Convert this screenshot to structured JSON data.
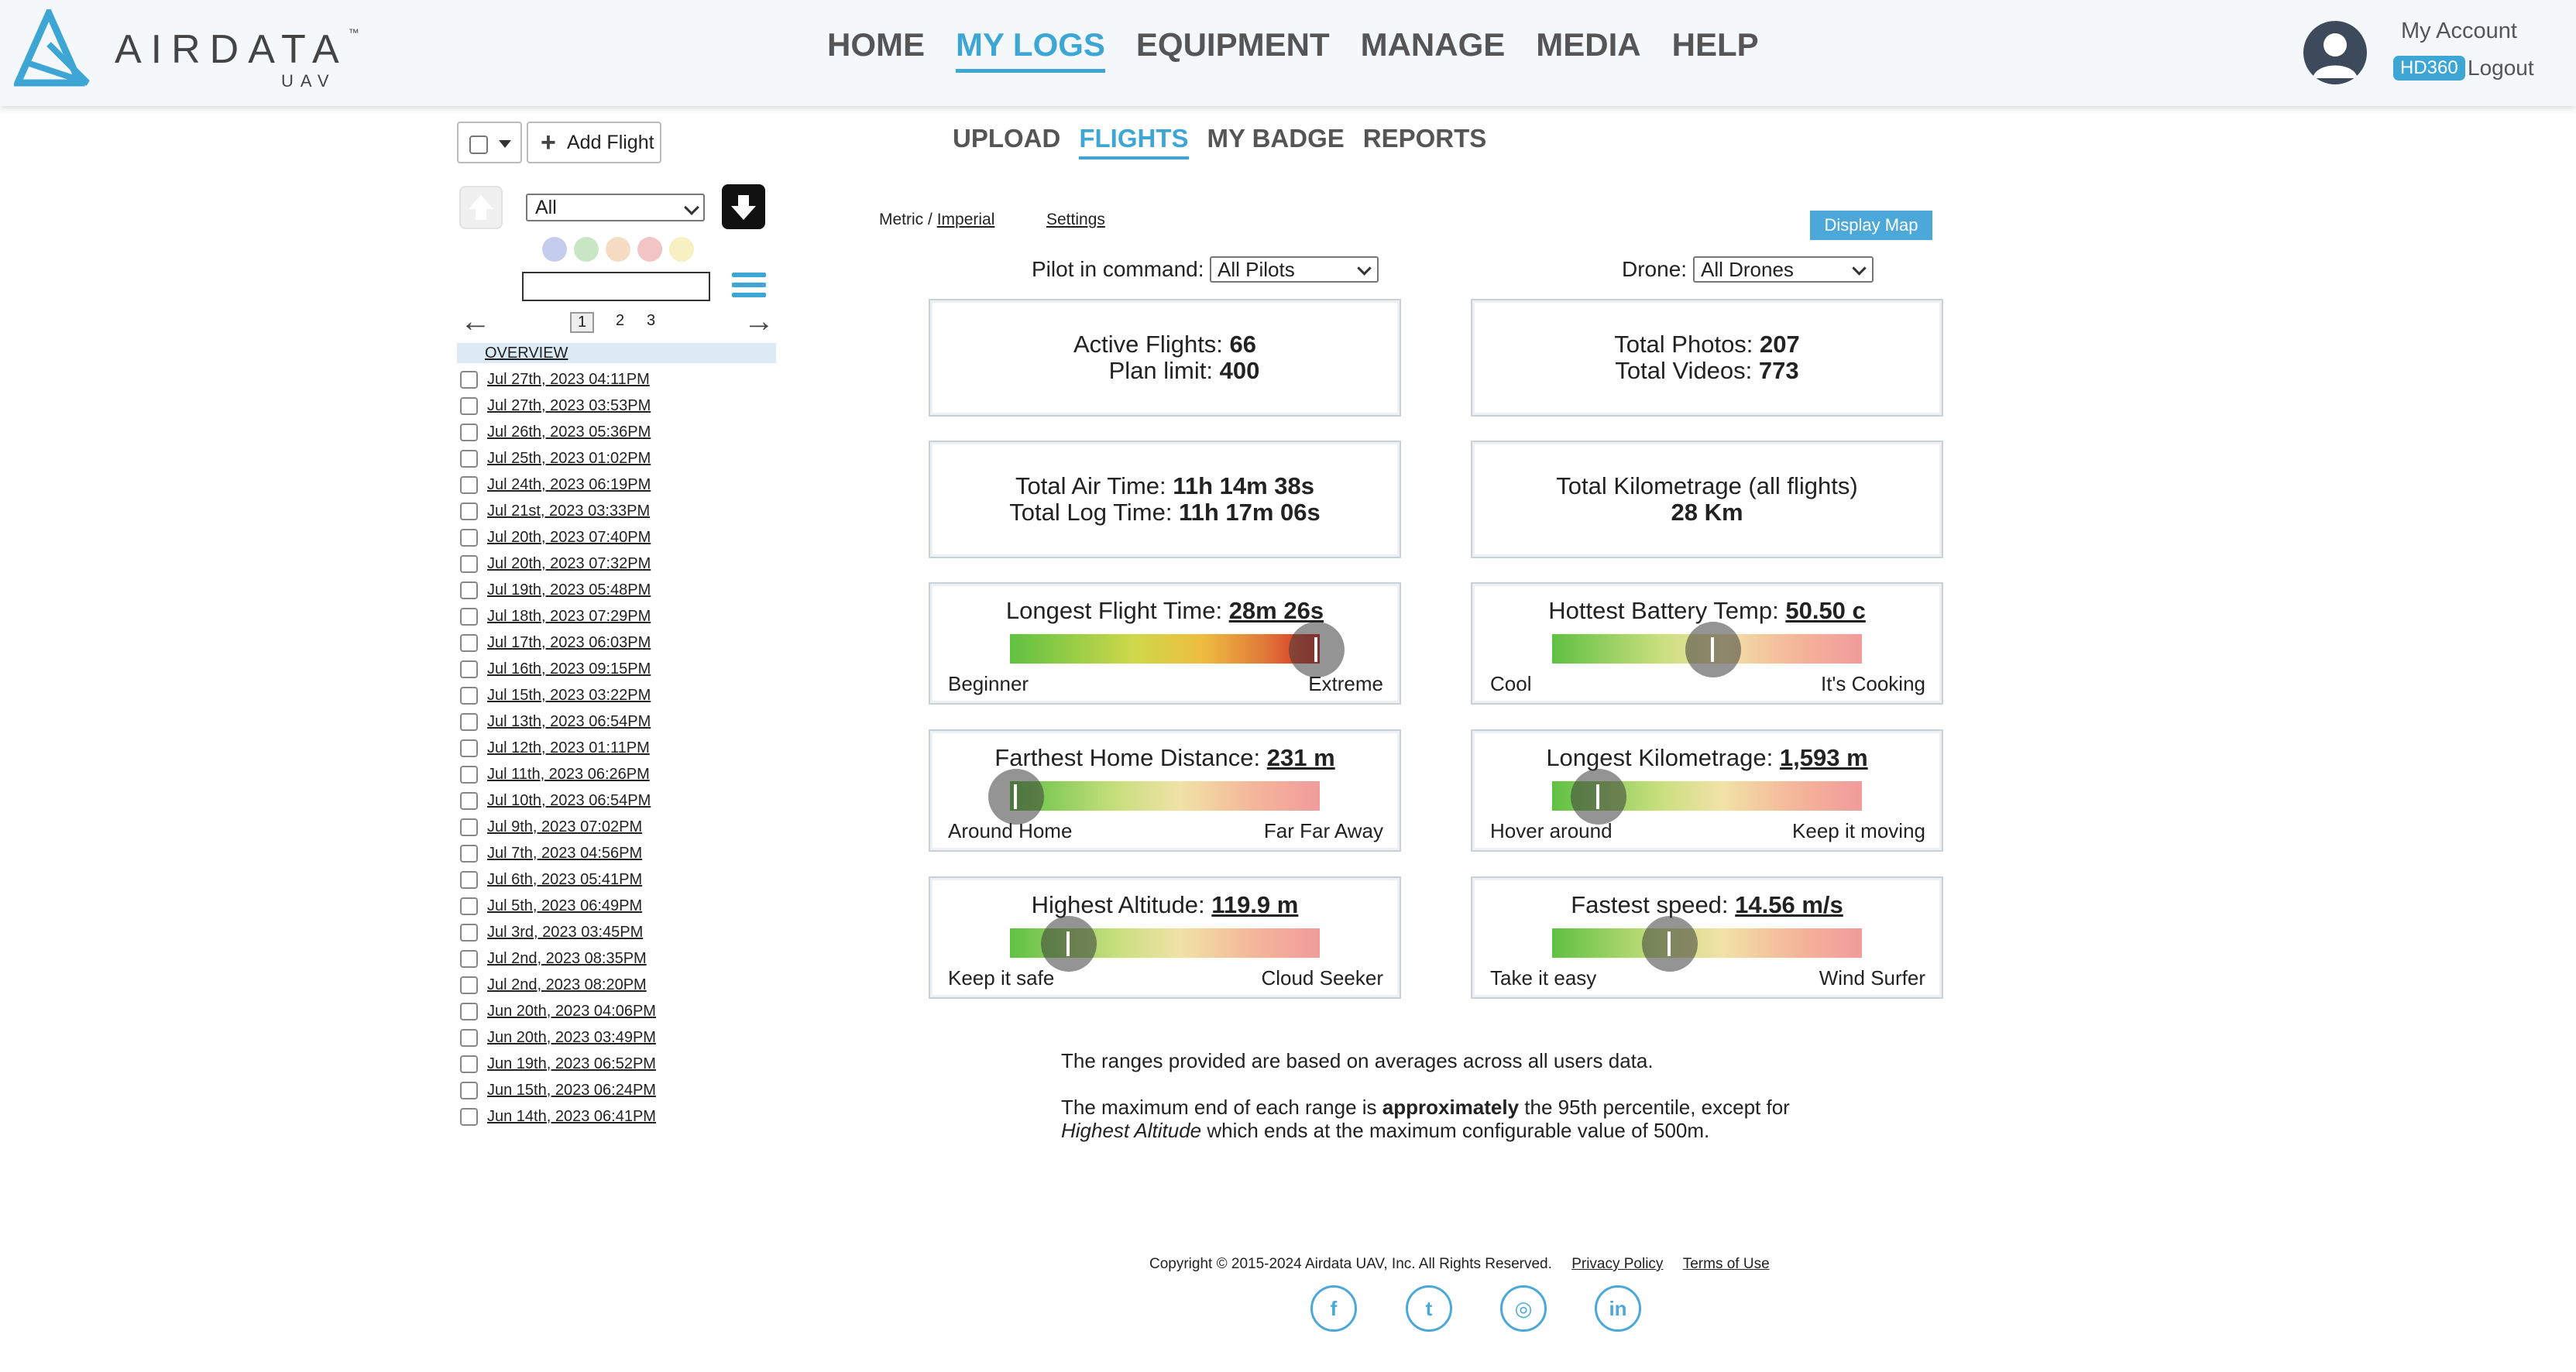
{
  "brand": {
    "name": "AIRDATA",
    "sub": "UAV",
    "tm": "™"
  },
  "nav": {
    "home": "HOME",
    "my_logs": "MY LOGS",
    "equipment": "EQUIPMENT",
    "manage": "MANAGE",
    "media": "MEDIA",
    "help": "HELP",
    "active": "MY LOGS"
  },
  "account": {
    "label": "My Account",
    "plan_badge": "HD360",
    "logout": "Logout"
  },
  "subnav": {
    "upload": "UPLOAD",
    "flights": "FLIGHTS",
    "my_badge": "MY BADGE",
    "reports": "REPORTS",
    "active": "FLIGHTS"
  },
  "sidebar": {
    "add_flight": "Add Flight",
    "filter_value": "All",
    "search_value": "",
    "pages": [
      "1",
      "2",
      "3"
    ],
    "current_page": "1",
    "overview": "OVERVIEW",
    "flights": [
      "Jul 27th, 2023 04:11PM",
      "Jul 27th, 2023 03:53PM",
      "Jul 26th, 2023 05:36PM",
      "Jul 25th, 2023 01:02PM",
      "Jul 24th, 2023 06:19PM",
      "Jul 21st, 2023 03:33PM",
      "Jul 20th, 2023 07:40PM",
      "Jul 20th, 2023 07:32PM",
      "Jul 19th, 2023 05:48PM",
      "Jul 18th, 2023 07:29PM",
      "Jul 17th, 2023 06:03PM",
      "Jul 16th, 2023 09:15PM",
      "Jul 15th, 2023 03:22PM",
      "Jul 13th, 2023 06:54PM",
      "Jul 12th, 2023 01:11PM",
      "Jul 11th, 2023 06:26PM",
      "Jul 10th, 2023 06:54PM",
      "Jul 9th, 2023 07:02PM",
      "Jul 7th, 2023 04:56PM",
      "Jul 6th, 2023 05:41PM",
      "Jul 5th, 2023 06:49PM",
      "Jul 3rd, 2023 03:45PM",
      "Jul 2nd, 2023 08:35PM",
      "Jul 2nd, 2023 08:20PM",
      "Jun 20th, 2023 04:06PM",
      "Jun 20th, 2023 03:49PM",
      "Jun 19th, 2023 06:52PM",
      "Jun 15th, 2023 06:24PM",
      "Jun 14th, 2023 06:41PM"
    ],
    "tag_colors": [
      "#c5cdef",
      "#c8e6c4",
      "#f6dcc3",
      "#f2c4c4",
      "#f7f0c2"
    ]
  },
  "toolbar": {
    "metric": "Metric",
    "sep": " / ",
    "imperial": "Imperial",
    "settings": "Settings",
    "display_map": "Display Map"
  },
  "filters": {
    "pilot_label": "Pilot in command:",
    "pilot_value": "All Pilots",
    "drone_label": "Drone:",
    "drone_value": "All Drones"
  },
  "stats": {
    "active_flights_label": "Active Flights:",
    "active_flights": "66",
    "plan_limit_label": "Plan limit:",
    "plan_limit": "400",
    "total_photos_label": "Total Photos:",
    "total_photos": "207",
    "total_videos_label": "Total Videos:",
    "total_videos": "773",
    "air_time_label": "Total Air Time:",
    "air_time": "11h 14m 38s",
    "log_time_label": "Total Log Time:",
    "log_time": "11h 17m 06s",
    "kilometrage_label": "Total Kilometrage (all flights)",
    "kilometrage": "28 Km"
  },
  "gauges": [
    {
      "id": "flight-time",
      "label": "Longest Flight Time:",
      "value": "28m 26s",
      "left": "Beginner",
      "right": "Extreme",
      "level": 0.99,
      "gradient": "linear-gradient(90deg,#5fc142 0%,#cfd84a 40%,#eebd3f 62%,#e07a3a 82%,#d62323 100%)"
    },
    {
      "id": "battery-temp",
      "label": "Hottest Battery Temp:",
      "value": "50.50 c",
      "left": "Cool",
      "right": "It's Cooking",
      "level": 0.52,
      "gradient": "linear-gradient(90deg,#5fc142 0%,#c9df7f 35%,#f1e2a6 55%,#f4b79a 78%,#f29b9b 100%)"
    },
    {
      "id": "home-distance",
      "label": "Farthest Home Distance:",
      "value": "231 m",
      "left": "Around Home",
      "right": "Far Far Away",
      "level": 0.02,
      "gradient": "linear-gradient(90deg,#5fc142 0%,#c9df7f 35%,#f1e2a6 55%,#f4b79a 78%,#f29b9b 100%)"
    },
    {
      "id": "longest-km",
      "label": "Longest Kilometrage:",
      "value": "1,593 m",
      "left": "Hover around",
      "right": "Keep it moving",
      "level": 0.15,
      "gradient": "linear-gradient(90deg,#5fc142 0%,#c9df7f 35%,#f1e2a6 55%,#f4b79a 78%,#f29b9b 100%)"
    },
    {
      "id": "altitude",
      "label": "Highest Altitude:",
      "value": "119.9 m",
      "left": "Keep it safe",
      "right": "Cloud Seeker",
      "level": 0.19,
      "gradient": "linear-gradient(90deg,#5fc142 0%,#c9df7f 35%,#f1e2a6 55%,#f4b79a 78%,#f29b9b 100%)"
    },
    {
      "id": "speed",
      "label": "Fastest speed:",
      "value": "14.56 m/s",
      "left": "Take it easy",
      "right": "Wind Surfer",
      "level": 0.38,
      "gradient": "linear-gradient(90deg,#5fc142 0%,#c9df7f 35%,#f1e2a6 55%,#f4b79a 78%,#f29b9b 100%)"
    }
  ],
  "notes": {
    "line1": "The ranges provided are based on averages across all users data.",
    "line2_a": "The maximum end of each range is ",
    "line2_b": "approximately",
    "line2_c": " the 95th percentile, except for ",
    "line2_d": "Highest Altitude",
    "line2_e": " which ends at the maximum configurable value of 500m."
  },
  "footer": {
    "copyright": "Copyright © 2015-2024 Airdata UAV, Inc. All Rights Reserved.",
    "privacy": "Privacy Policy",
    "terms": "Terms of Use",
    "social": [
      {
        "name": "facebook",
        "glyph": "f"
      },
      {
        "name": "twitter",
        "glyph": "t"
      },
      {
        "name": "instagram",
        "glyph": "◎"
      },
      {
        "name": "linkedin",
        "glyph": "in"
      }
    ]
  },
  "colors": {
    "accent": "#3ea6d4",
    "map_button": "#4ba8d8"
  }
}
